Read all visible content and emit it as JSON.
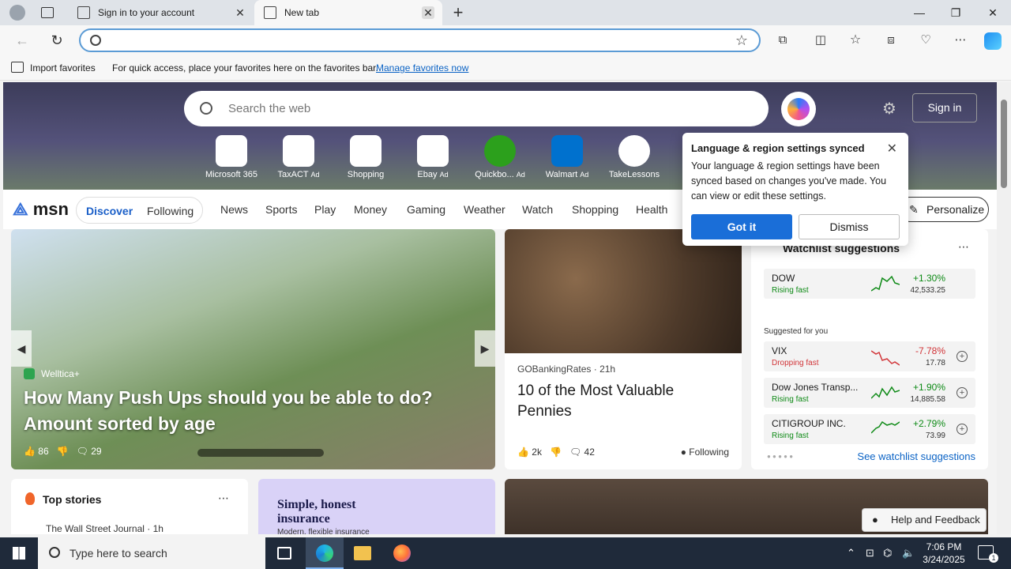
{
  "browser": {
    "tabs": [
      {
        "label": "Sign in to your account"
      },
      {
        "label": "New tab"
      }
    ],
    "address_placeholder": ""
  },
  "favorites_bar": {
    "import_label": "Import favorites",
    "hint": "For quick access, place your favorites here on the favorites bar.",
    "manage_link": "Manage favorites now"
  },
  "search": {
    "placeholder": "Search the web"
  },
  "header": {
    "sign_in": "Sign in"
  },
  "quick_links": [
    {
      "label": "Microsoft 365",
      "ad": ""
    },
    {
      "label": "TaxACT",
      "ad": "Ad"
    },
    {
      "label": "Shopping",
      "ad": ""
    },
    {
      "label": "Ebay",
      "ad": "Ad"
    },
    {
      "label": "Quickbo...",
      "ad": "Ad"
    },
    {
      "label": "Walmart",
      "ad": "Ad"
    },
    {
      "label": "TakeLessons",
      "ad": ""
    }
  ],
  "msn": {
    "logo_icon": "msn",
    "logo_text": "msn",
    "discover": "Discover",
    "following": "Following",
    "nav": [
      "News",
      "Sports",
      "Play",
      "Money",
      "Gaming",
      "Weather",
      "Watch",
      "Shopping",
      "Health"
    ],
    "personalize": "Personalize"
  },
  "hero_story": {
    "source": "Welltica+",
    "headline": "How Many Push Ups should you be able to do? Amount sorted by age",
    "likes": "86",
    "comments": "29"
  },
  "pennies_story": {
    "source": "GOBankingRates",
    "age": "21h",
    "title": "10 of the Most Valuable Pennies",
    "likes": "2k",
    "comments": "42",
    "following": "Following"
  },
  "watchlist": {
    "header": "Watchlist suggestions",
    "suggested_label": "Suggested for you",
    "see_all": "See watchlist suggestions",
    "stocks": [
      {
        "name": "DOW",
        "status": "Rising fast",
        "change": "+1.30%",
        "price": "42,533.25",
        "up": true
      },
      {
        "name": "VIX",
        "status": "Dropping fast",
        "change": "-7.78%",
        "price": "17.78",
        "up": false
      },
      {
        "name": "Dow Jones Transp...",
        "status": "Rising fast",
        "change": "+1.90%",
        "price": "14,885.58",
        "up": true
      },
      {
        "name": "CITIGROUP INC.",
        "status": "Rising fast",
        "change": "+2.79%",
        "price": "73.99",
        "up": true
      }
    ],
    "colors": {
      "up": "#0e8a16",
      "down": "#d13438"
    }
  },
  "top_stories": {
    "title": "Top stories",
    "source": "The Wall Street Journal · 1h"
  },
  "insurance_ad": {
    "headline": "Simple, honest insurance",
    "sub": "Modern, flexible insurance"
  },
  "help": {
    "label": "Help and Feedback"
  },
  "popup": {
    "title": "Language & region settings synced",
    "body": "Your language & region settings have been synced based on changes you've made. You can view or edit these settings.",
    "got_it": "Got it",
    "dismiss": "Dismiss"
  },
  "taskbar": {
    "search_placeholder": "Type here to search",
    "time": "7:06 PM",
    "date": "3/24/2025",
    "notifications": "1"
  }
}
